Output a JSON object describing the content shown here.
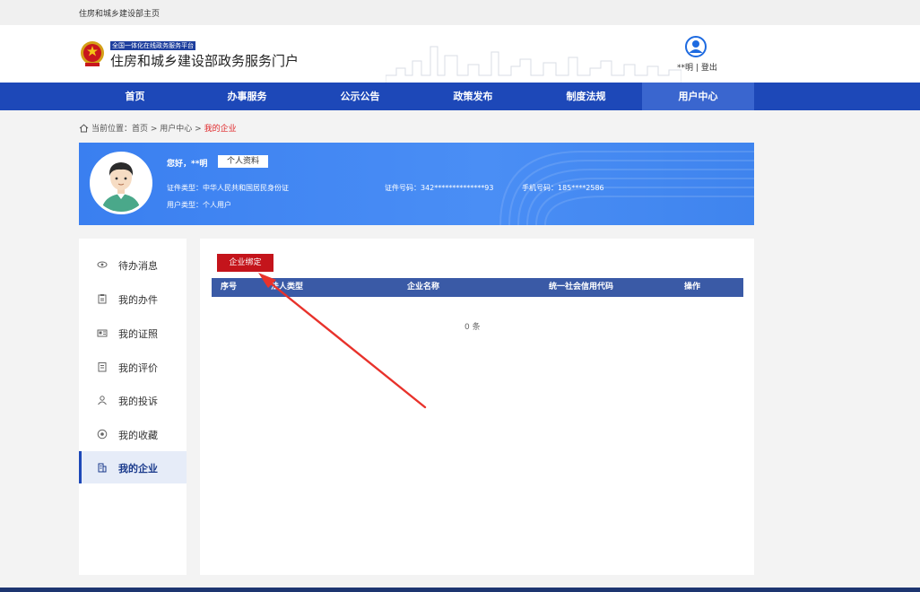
{
  "topbar": {
    "link": "住房和城乡建设部主页"
  },
  "header": {
    "badge": "全国一体化在线政务服务平台",
    "title": "住房和城乡建设部政务服务门户",
    "user_name": "**明",
    "separator": "|",
    "logout": "登出"
  },
  "nav": {
    "items": [
      {
        "label": "首页"
      },
      {
        "label": "办事服务"
      },
      {
        "label": "公示公告"
      },
      {
        "label": "政策发布"
      },
      {
        "label": "制度法规"
      },
      {
        "label": "用户中心",
        "active": true
      }
    ]
  },
  "breadcrumb": {
    "prefix": "当前位置：",
    "home": "首页",
    "sep": " > ",
    "level2": "用户中心",
    "current": "我的企业"
  },
  "profile": {
    "greeting": "您好，**明",
    "profile_button": "个人资料",
    "id_type": "证件类型：中华人民共和国居民身份证",
    "user_type": "用户类型：个人用户",
    "id_number": "证件号码：342**************93",
    "phone": "手机号码：185****2586"
  },
  "sidebar": {
    "items": [
      {
        "label": "待办消息",
        "icon": "eye-icon"
      },
      {
        "label": "我的办件",
        "icon": "clipboard-icon"
      },
      {
        "label": "我的证照",
        "icon": "id-card-icon"
      },
      {
        "label": "我的评价",
        "icon": "note-icon"
      },
      {
        "label": "我的投诉",
        "icon": "complaint-icon"
      },
      {
        "label": "我的收藏",
        "icon": "star-icon"
      },
      {
        "label": "我的企业",
        "icon": "building-icon",
        "active": true
      }
    ]
  },
  "main": {
    "bind_button": "企业绑定",
    "columns": [
      "序号",
      "法人类型",
      "企业名称",
      "统一社会信用代码",
      "操作"
    ],
    "empty_text": "0 条"
  },
  "colors": {
    "nav_bg": "#1d48b8",
    "nav_active": "#3a66cf",
    "accent_red": "#c4141b",
    "table_header": "#3a5aa6",
    "banner_blue": "#4a8ef5"
  }
}
